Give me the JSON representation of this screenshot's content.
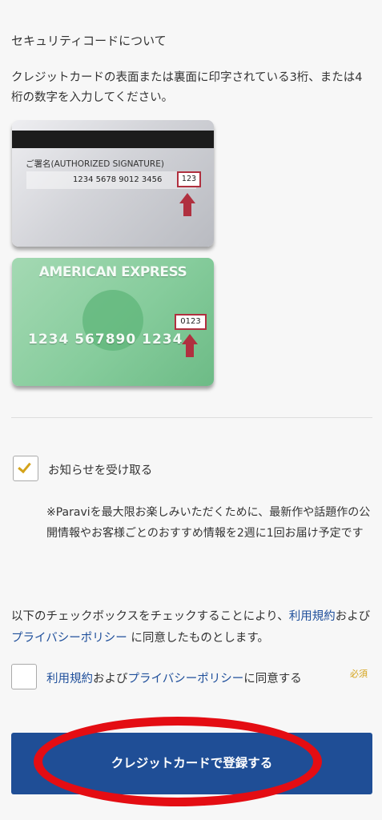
{
  "security": {
    "title": "セキュリティコードについて",
    "description": "クレジットカードの表面または裏面に印字されている3桁、または4桁の数字を入力してください。"
  },
  "card_back": {
    "signature_label": "ご署名(AUTHORIZED SIGNATURE)",
    "number": "1234 5678 9012 3456",
    "cvv": "123"
  },
  "card_amex": {
    "brand": "AMERICAN EXPRESS",
    "number": "1234  567890  1234",
    "cid": "0123"
  },
  "newsletter": {
    "checked": true,
    "label": "お知らせを受け取る",
    "note": "※Paraviを最大限お楽しみいただくために、最新作や話題作の公開情報やお客様ごとのおすすめ情報を2週に1回お届け予定です"
  },
  "agreement": {
    "text_before": "以下のチェックボックスをチェックすることにより、",
    "terms_link": "利用規約",
    "and": "および",
    "privacy_link": "プライバシーポリシー",
    "text_after": " に同意したものとします。"
  },
  "terms_checkbox": {
    "checked": false,
    "terms_link": "利用規約",
    "and": "および",
    "privacy_link": "プライバシーポリシー",
    "suffix": "に同意する",
    "required_badge": "必須"
  },
  "submit_button": {
    "label": "クレジットカードで登録する"
  },
  "colors": {
    "button_bg": "#1f4e96",
    "link": "#1f4f9b",
    "check_gold": "#d4a31a",
    "highlight_red": "#b0303f",
    "annotation_red": "#e40d13"
  }
}
